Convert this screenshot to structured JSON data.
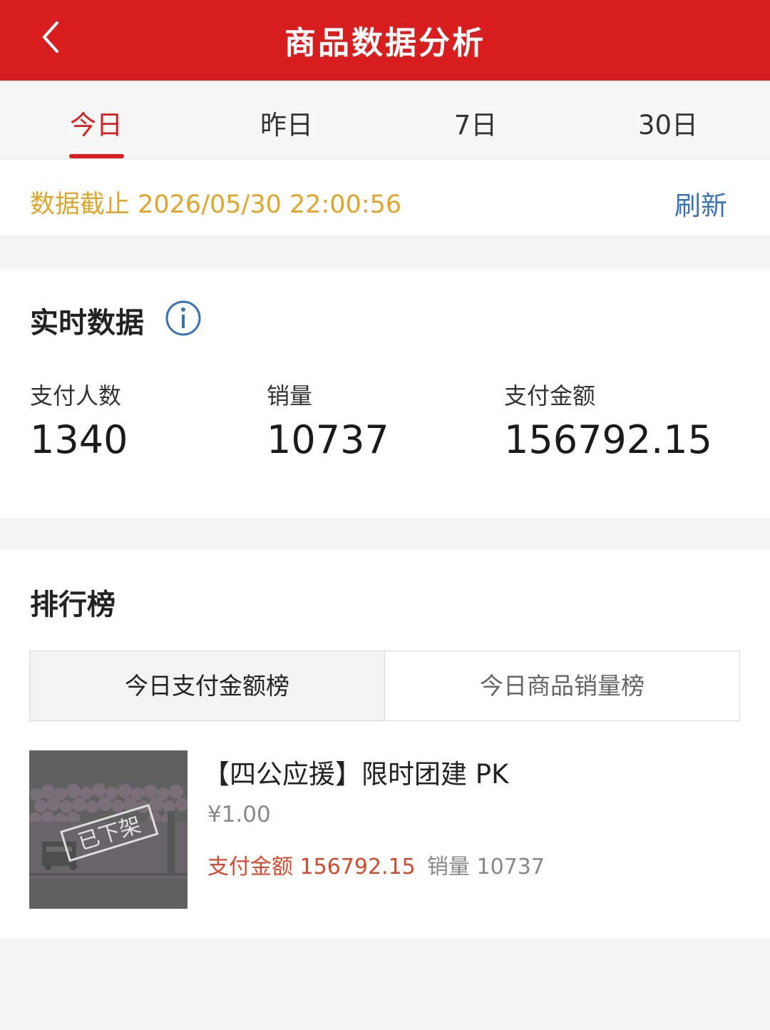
{
  "header": {
    "title": "商品数据分析",
    "back_icon": "chevron-left-icon",
    "background": "#d81e1e"
  },
  "tabs": [
    {
      "label": "今日",
      "active": true
    },
    {
      "label": "昨日",
      "active": false
    },
    {
      "label": "7日",
      "active": false
    },
    {
      "label": "30日",
      "active": false
    }
  ],
  "notice": {
    "text": "数据截止 2026/05/30 22:00:56",
    "refresh_label": "刷新"
  },
  "realtime": {
    "title": "实时数据",
    "info_icon": "info-icon",
    "metrics": [
      {
        "label": "支付人数",
        "value": "1340"
      },
      {
        "label": "销量",
        "value": "10737"
      },
      {
        "label": "支付金额",
        "value": "156792.15"
      }
    ]
  },
  "ranking": {
    "title": "排行榜",
    "segments": [
      {
        "label": "今日支付金额榜",
        "selected": true
      },
      {
        "label": "今日商品销量榜",
        "selected": false
      }
    ],
    "items": [
      {
        "title": "【四公应援】限时团建 PK",
        "price": "¥1.00",
        "pay_amount": "支付金额 156792.15",
        "sales": "销量 10737",
        "stamp": "已下架"
      }
    ]
  },
  "colors": {
    "accent": "#d81e1e",
    "notice": "#e0a52a",
    "link": "#3a72b6",
    "pay_amount": "#d7492f"
  }
}
